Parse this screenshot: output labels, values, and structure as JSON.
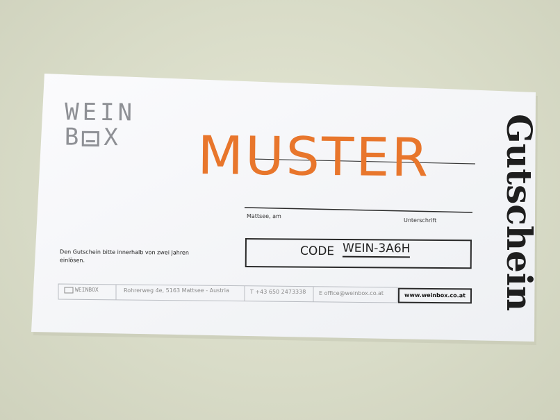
{
  "voucher": {
    "logo_line1": "WEIN",
    "logo_line2": "B",
    "logo_line2_end": "X",
    "stamp": "MUSTER",
    "title": "Gutschein",
    "place_label": "Mattsee, am",
    "signature_label": "Unterschrift",
    "note": "Den Gutschein bitte innerhalb von zwei Jahren einlösen.",
    "code_label": "CODE",
    "code_value": "WEIN-3A6H",
    "accent_color": "#e8762c",
    "footer": {
      "brand": "WEINBOX",
      "address": "Rohrerweg 4e, 5163 Mattsee - Austria",
      "phone": "T +43 650 2473338",
      "email": "E office@weinbox.co.at",
      "website": "www.weinbox.co.at"
    }
  }
}
